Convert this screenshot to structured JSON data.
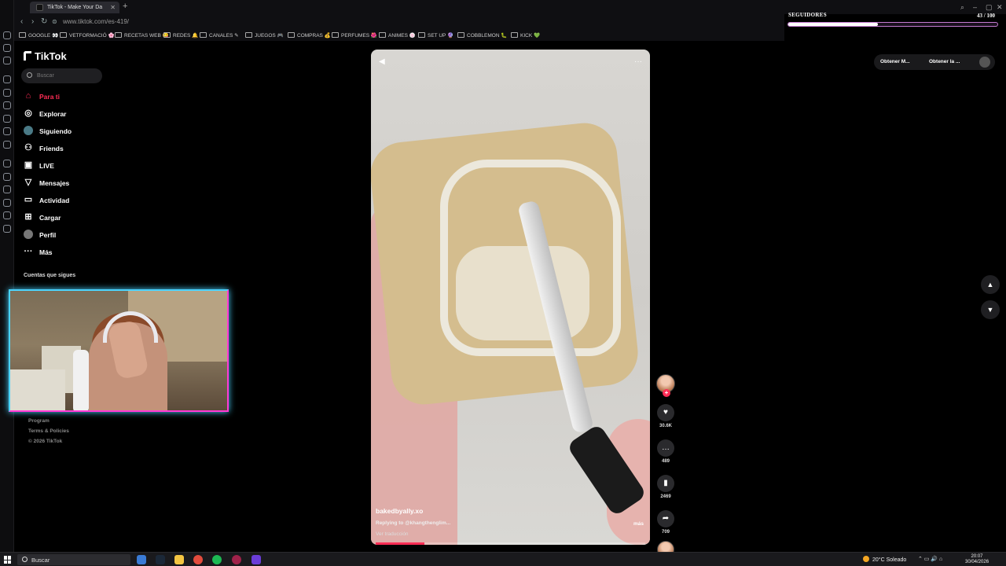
{
  "browser": {
    "tab_title": "TikTok - Make Your Da",
    "url": "www.tiktok.com/es-419/",
    "bookmarks": [
      "GOOGLE 👀",
      "VETFORMACIÓ 🌸",
      "RECETAS WEB 😋",
      "REDES 🔔",
      "CANALES ✎",
      "JUEGOS 🎮",
      "COMPRAS 💰",
      "PERFUMES 🌺",
      "ANIMES 🍥",
      "SET UP 🔮",
      "COBBLEMON 🐛",
      "KICK 💚"
    ]
  },
  "followers_overlay": {
    "title": "SEGUIDORES",
    "count": "43 / 100",
    "progress": 0.43
  },
  "tiktok": {
    "logo": "TikTok",
    "search_placeholder": "Buscar",
    "nav": [
      {
        "label": "Para ti",
        "icon": "home-icon"
      },
      {
        "label": "Explorar",
        "icon": "compass-icon"
      },
      {
        "label": "Siguiendo",
        "icon": "following-avatar-icon"
      },
      {
        "label": "Friends",
        "icon": "friends-icon"
      },
      {
        "label": "LIVE",
        "icon": "live-icon"
      },
      {
        "label": "Mensajes",
        "icon": "send-icon"
      },
      {
        "label": "Actividad",
        "icon": "activity-icon"
      },
      {
        "label": "Cargar",
        "icon": "upload-icon"
      },
      {
        "label": "Perfil",
        "icon": "profile-avatar-icon"
      },
      {
        "label": "Más",
        "icon": "more-icon"
      }
    ],
    "following_title": "Cuentas que sigues",
    "footer": [
      "Program",
      "Terms & Policies",
      "© 2026 TikTok"
    ],
    "get_app": [
      "Obtener M...",
      "Obtener la ..."
    ]
  },
  "video": {
    "author": "bakedbyally.xo",
    "reply": "Replying to @khangthenglim...",
    "more": "más",
    "translate": "Ver traducción",
    "progress": 0.18,
    "likes": "30.6K",
    "comments": "489",
    "saves": "2469",
    "shares": "709"
  },
  "taskbar": {
    "search": "Buscar",
    "weather": "20°C  Soleado",
    "time": "20:07",
    "date": "30/04/2026"
  },
  "colors": {
    "accent": "#fe2c55",
    "webcam_glow": "#4ad4ff",
    "webcam_border": "#ff3ad6"
  }
}
